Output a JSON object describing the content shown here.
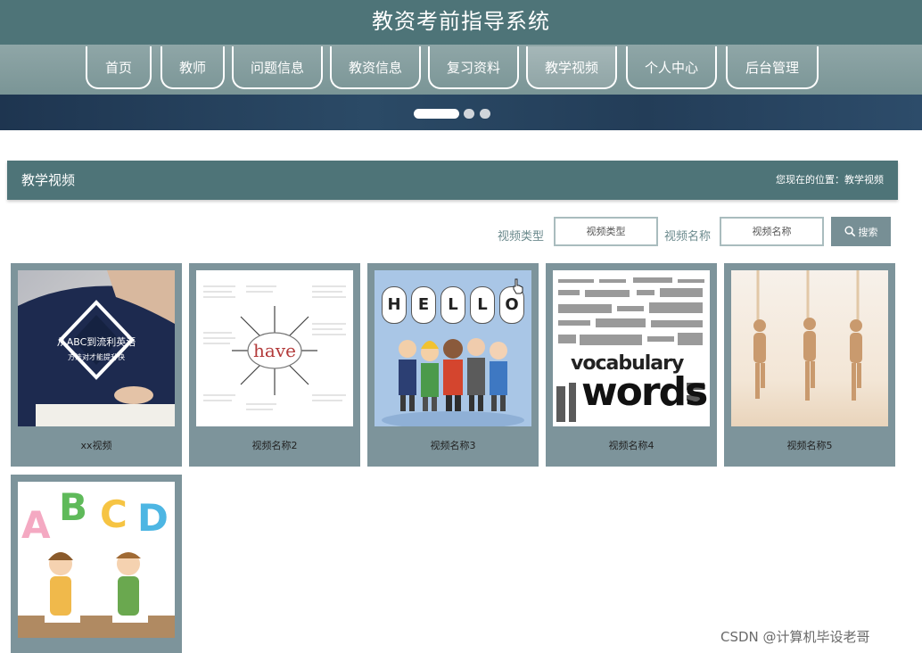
{
  "header": {
    "title": "教资考前指导系统"
  },
  "nav": {
    "items": [
      {
        "label": "首页"
      },
      {
        "label": "教师"
      },
      {
        "label": "问题信息"
      },
      {
        "label": "教资信息"
      },
      {
        "label": "复习资料"
      },
      {
        "label": "教学视频"
      },
      {
        "label": "个人中心"
      },
      {
        "label": "后台管理"
      }
    ],
    "active": "教学视频"
  },
  "section": {
    "title": "教学视频",
    "breadcrumb": "您现在的位置：教学视频"
  },
  "filters": {
    "type_label": "视频类型",
    "type_placeholder": "视频类型",
    "name_label": "视频名称",
    "name_placeholder": "视频名称",
    "search_label": "搜索"
  },
  "thumb_text": {
    "v1_line1": "从ABC到流利英语",
    "v1_line2": "方法对才能提升快",
    "v2_center": "have",
    "v3_letters": [
      "H",
      "E",
      "L",
      "L",
      "O"
    ],
    "v4_big": "words",
    "v4_mid": "vocabulary",
    "v6_letters": [
      "A",
      "B",
      "C",
      "D"
    ]
  },
  "videos": [
    {
      "title": "xx视频"
    },
    {
      "title": "视频名称2"
    },
    {
      "title": "视频名称3"
    },
    {
      "title": "视频名称4"
    },
    {
      "title": "视频名称5"
    },
    {
      "title": ""
    }
  ],
  "watermark": "CSDN @计算机毕设老哥",
  "colors": {
    "header_bg": "#4e7478",
    "nav_band": "#8fa6a7",
    "card_bg": "#7d949b",
    "search_button": "#778f95",
    "banner": "#1e3550"
  },
  "icons": {
    "search": "magnifier-icon"
  }
}
